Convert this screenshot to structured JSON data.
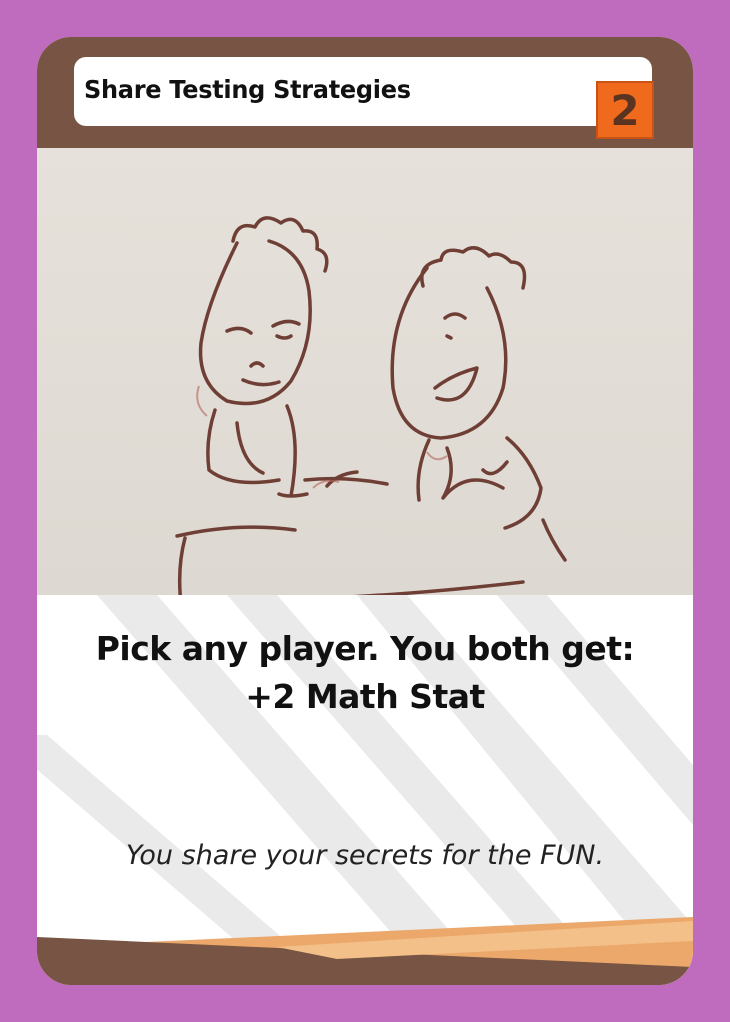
{
  "card": {
    "title": "Share Testing Strategies",
    "cost": "2",
    "effect_line1": "Pick any player. You both get:",
    "effect_line2": "+2 Math Stat",
    "flavor_text": "You share your secrets for the FUN."
  },
  "colors": {
    "background": "#bf6cbf",
    "header": "#775443",
    "cost_badge": "#ef6a1c",
    "footer_dark": "#775443",
    "footer_light": "#eba86a",
    "sketch_ink": "#7a4035"
  },
  "art": {
    "subject": "hand-drawn-sketch-two-people-at-table"
  }
}
